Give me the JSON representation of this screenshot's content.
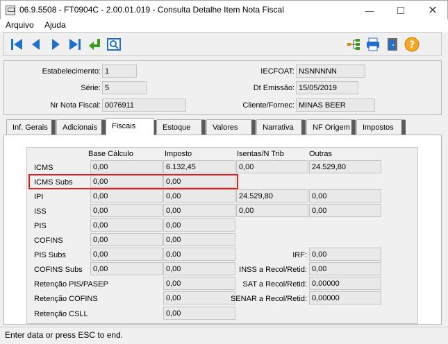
{
  "window": {
    "title": "06.9.5508 - FT0904C - 2.00.01.019 - Consulta Detalhe Item Nota Fiscal"
  },
  "menu": [
    "Arquivo",
    "Ajuda"
  ],
  "header": {
    "estabelecimento_label": "Estabelecimento:",
    "estabelecimento": "1",
    "serie_label": "Série:",
    "serie": "5",
    "nr_nota_label": "Nr Nota Fiscal:",
    "nr_nota": "0076911",
    "iecfoat_label": "IECFOAT:",
    "iecfoat": "NSNNNNN",
    "dt_emissao_label": "Dt Emissão:",
    "dt_emissao": "15/05/2019",
    "cliente_label": "Cliente/Fornec:",
    "cliente": "MINAS BEER"
  },
  "tabs": [
    "Inf. Gerais",
    "Adicionais",
    "Fiscais",
    "Estoque",
    "Valores",
    "Narrativa",
    "NF Origem",
    "Impostos"
  ],
  "active_tab": "Fiscais",
  "fiscais": {
    "columns": [
      "Base Cálculo",
      "Imposto",
      "Isentas/N Trib",
      "Outras"
    ],
    "rows": [
      {
        "label": "ICMS",
        "values": [
          "0,00",
          "6.132,45",
          "0,00",
          "24.529,80"
        ]
      },
      {
        "label": "ICMS Subs",
        "values": [
          "0,00",
          "0,00"
        ]
      },
      {
        "label": "IPI",
        "values": [
          "0,00",
          "0,00",
          "24.529,80",
          "0,00"
        ]
      },
      {
        "label": "ISS",
        "values": [
          "0,00",
          "0,00",
          "0,00",
          "0,00"
        ]
      },
      {
        "label": "PIS",
        "values": [
          "0,00",
          "0,00"
        ]
      },
      {
        "label": "COFINS",
        "values": [
          "0,00",
          "0,00"
        ]
      },
      {
        "label": "PIS Subs",
        "values": [
          "0,00",
          "0,00"
        ]
      },
      {
        "label": "COFINS Subs",
        "values": [
          "0,00",
          "0,00"
        ]
      },
      {
        "label": "Retenção PIS/PASEP",
        "values": [
          "",
          "0,00"
        ]
      },
      {
        "label": "Retenção COFINS",
        "values": [
          "",
          "0,00"
        ]
      },
      {
        "label": "Retenção CSLL",
        "values": [
          "",
          "0,00"
        ]
      }
    ],
    "right": [
      {
        "label": "IRF:",
        "value": "0,00"
      },
      {
        "label": "INSS a Recol/Retid:",
        "value": "0,00"
      },
      {
        "label": "SAT a Recol/Retid:",
        "value": "0,00000"
      },
      {
        "label": "SENAR a Recol/Retid:",
        "value": "0,00000"
      }
    ]
  },
  "status": "Enter data or press ESC to end.",
  "colors": {
    "highlight": "#e02020",
    "toolbar_blue": "#1e6fd0",
    "help_orange": "#f5a623"
  }
}
